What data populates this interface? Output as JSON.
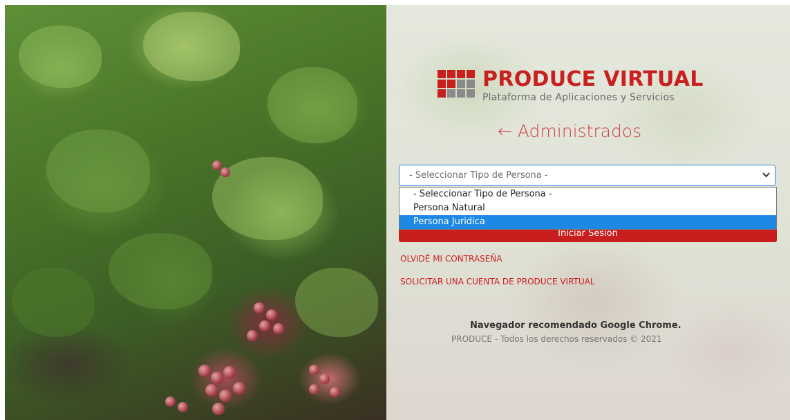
{
  "brand": {
    "title": "PRODUCE VIRTUAL",
    "subtitle": "Plataforma de Aplicaciones y Servicios",
    "primary_color": "#c81f1f"
  },
  "admin_link": {
    "label": "← Administrados"
  },
  "person_type_select": {
    "selected": "- Seleccionar Tipo de Persona -",
    "options": [
      "- Seleccionar Tipo de Persona -",
      "Persona Natural",
      "Persona Juridica"
    ],
    "highlighted_index": 2
  },
  "login_button": {
    "label": "Iniciar Sesión"
  },
  "links": {
    "forgot_password": "OLVIDÉ MI CONTRASEÑA",
    "request_account": "SOLICITAR UNA CUENTA DE PRODUCE VIRTUAL"
  },
  "footer": {
    "browser_note": "Navegador recomendado Google Chrome.",
    "copyright": "PRODUCE - Todos los derechos reservados © 2021"
  }
}
